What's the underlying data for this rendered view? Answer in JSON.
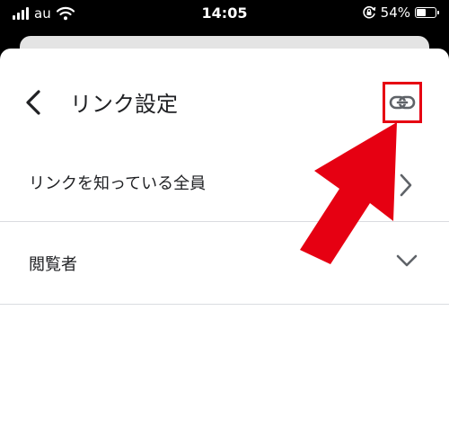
{
  "status_bar": {
    "carrier": "au",
    "time": "14:05",
    "battery_percent": "54%",
    "battery_level": 0.54,
    "icons": [
      "signal-icon",
      "wifi-icon",
      "orientation-lock-icon",
      "battery-icon"
    ]
  },
  "header": {
    "back_icon": "chevron-left-icon",
    "title": "リンク設定",
    "link_icon": "link-icon"
  },
  "settings": {
    "access": {
      "label": "リンクを知っている全員",
      "icon": "chevron-right-icon"
    },
    "role": {
      "label": "閲覧者",
      "icon": "chevron-down-icon"
    }
  },
  "colors": {
    "highlight": "#e60012",
    "text": "#202124",
    "icon": "#5f6368",
    "divider": "#dadce0"
  }
}
